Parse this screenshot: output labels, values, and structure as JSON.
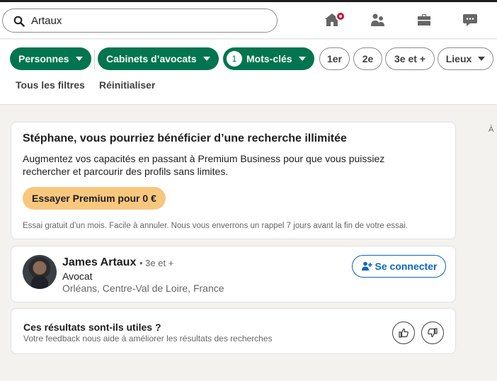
{
  "search": {
    "value": "Artaux"
  },
  "nav": {
    "icons": [
      "home-icon",
      "people-icon",
      "briefcase-icon",
      "messaging-icon"
    ]
  },
  "filters": {
    "personnes": "Personnes",
    "cabinets": "Cabinets d’avocats",
    "motscles_count": "1",
    "motscles": "Mots-clés",
    "deg1": "1er",
    "deg2": "2e",
    "deg3": "3e et +",
    "lieux": "Lieux",
    "all_filters": "Tous les filtres",
    "reset": "Réinitialiser"
  },
  "premium": {
    "heading": "Stéphane, vous pourriez bénéficier d’une recherche illimitée",
    "body": "Augmentez vos capacités en passant à Premium Business pour que vous puissiez rechercher et parcourir des profils sans limites.",
    "button": "Essayer Premium pour 0 €",
    "note": "Essai gratuit d’un mois. Facile à annuler. Nous vous enverrons un rappel 7 jours avant la fin de votre essai."
  },
  "result": {
    "name": "James Artaux",
    "degree": "• 3e et +",
    "title": "Avocat",
    "location": "Orléans, Centre-Val de Loire, France",
    "connect": "Se connecter"
  },
  "feedback": {
    "title": "Ces résultats sont-ils utiles ?",
    "subtitle": "Votre feedback nous aide à améliorer les résultats des recherches"
  },
  "right_edge_text": "À",
  "colors": {
    "green": "#01754f",
    "blue": "#0a66c2",
    "premium": "#f8c77e",
    "badge": "#cb112d"
  }
}
